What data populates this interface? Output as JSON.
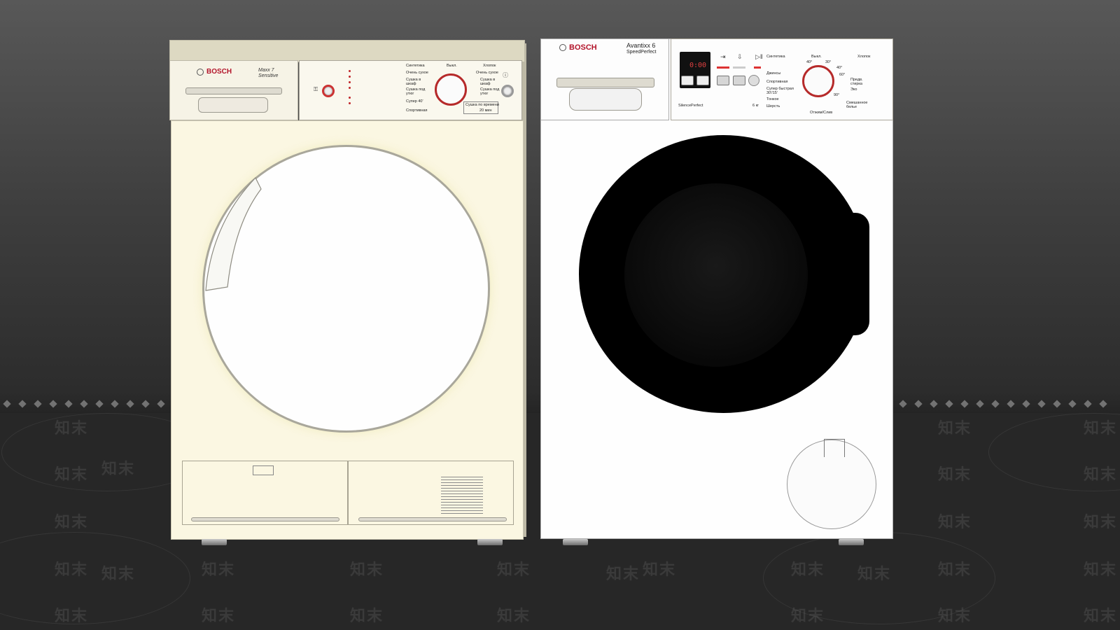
{
  "dryer": {
    "brand": "BOSCH",
    "model": "Maxx 7",
    "model_sub": "Sensitive",
    "programs_left": [
      "Синтетика",
      "Очень сухое",
      "Сушка в шкаф",
      "Сушка под утюг",
      "Супер 40'",
      "Спортивная"
    ],
    "programs_right": [
      "Хлопок",
      "Очень сухое",
      "Сушка в шкаф",
      "Сушка под утюг"
    ],
    "off_label": "Выкл.",
    "time_dry_label": "Сушка по времени",
    "time_dry_value": "20 мин"
  },
  "washer": {
    "brand": "BOSCH",
    "model": "Avantixx 6",
    "model_sub": "SpeedPerfect",
    "series_label": "SilencePerfect",
    "capacity": "6 кг",
    "display_time": "0:00",
    "programs_left": [
      "Синтетика",
      "Джинсы",
      "Спортивная",
      "Супер быстрая 30'/15'",
      "Тонкое",
      "Шерсть"
    ],
    "programs_right": [
      "Хлопок",
      "Предв. стирка",
      "Эко",
      "Смешанное белье"
    ],
    "off_label": "Выкл.",
    "temps_top": [
      "40°",
      "30°"
    ],
    "temps_right": [
      "40°",
      "60°",
      "90°"
    ],
    "spin_label": "Отжим/Слив"
  },
  "watermark": {
    "text": "知末"
  },
  "colors": {
    "brand_red": "#b3152b",
    "dryer_body": "#fbf7e2",
    "washer_body": "#fefefe",
    "background_top": "#585858",
    "floor": "#272727"
  }
}
